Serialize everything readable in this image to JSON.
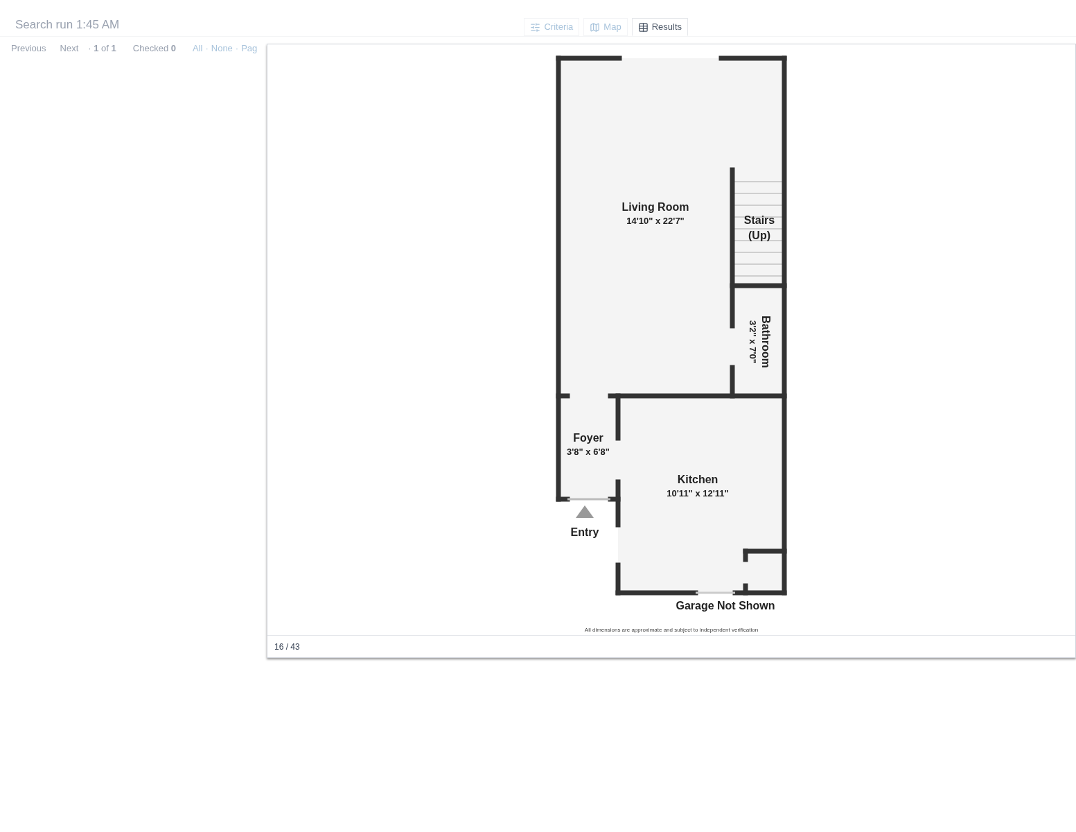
{
  "header": {
    "title": "Search run 1:45 AM"
  },
  "tabs": [
    {
      "label": "Criteria",
      "selected": false
    },
    {
      "label": "Map",
      "selected": false
    },
    {
      "label": "Results",
      "selected": true
    }
  ],
  "pager": {
    "previous": "Previous",
    "next": "Next",
    "page_info": "· **1** of **1**",
    "checked": "Checked **0**",
    "links": [
      "All",
      "·",
      "None",
      "·",
      "Pag"
    ]
  },
  "lightbox": {
    "counter": "16 / 43",
    "floor_plan": {
      "rooms": [
        {
          "name": "Living Room",
          "size": "14'10\" x 22'7\"",
          "kind": "plain"
        },
        {
          "name": "Stairs",
          "size": "(Up)",
          "kind": "stairs"
        },
        {
          "name": "Bathroom",
          "size": "3'2\" x 7'0\"",
          "kind": "rotated"
        },
        {
          "name": "Foyer",
          "size": "3'8\" x 6'8\"",
          "kind": "plain"
        },
        {
          "name": "Kitchen",
          "size": "10'11\" x 12'11\"",
          "kind": "plain"
        }
      ],
      "entry": "Entry",
      "garage_note": "Garage Not Shown",
      "disclaimer": "All dimensions are approximate and subject to independent verification"
    }
  }
}
